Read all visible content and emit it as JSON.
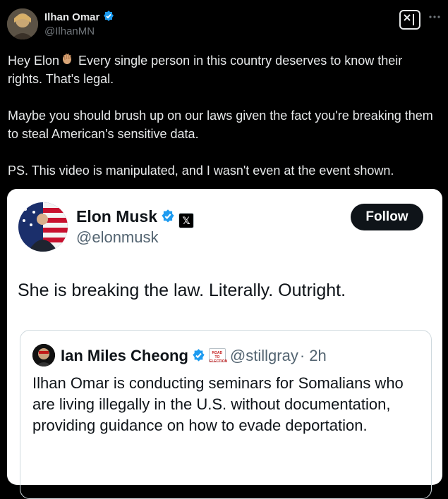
{
  "post": {
    "author_name": "Ilhan Omar",
    "author_handle": "@IlhanMN",
    "text_p1_a": "Hey Elon",
    "text_p1_b": " Every single person in this country deserves to know their rights. That's legal.",
    "text_p2": "Maybe you should brush up on our laws given the fact you're breaking them to steal American's sensitive data.",
    "text_p3": "PS. This video is manipulated, and I wasn't even at the event shown."
  },
  "embedded": {
    "author_name": "Elon Musk",
    "author_handle": "@elonmusk",
    "follow_label": "Follow",
    "text": "She is breaking the law. Literally. Outright.",
    "quote": {
      "author_name": "Ian Miles Cheong",
      "badge_text": "ROAD TO ELECTION",
      "author_handle": "@stillgray",
      "time": "· 2h",
      "text": "Ilhan Omar is conducting seminars for Somalians who are living illegally in the U.S. without documentation, providing guidance on how to evade deportation."
    }
  },
  "icons": {
    "verified": "verified-badge-icon",
    "grok": "grok-icon",
    "more": "more-options-icon",
    "wave": "waving-hand-emoji",
    "x_logo": "x-logo-icon"
  },
  "colors": {
    "background": "#000000",
    "verified_blue": "#1d9bf0",
    "card_background": "#ffffff",
    "secondary_text": "#71767b"
  }
}
